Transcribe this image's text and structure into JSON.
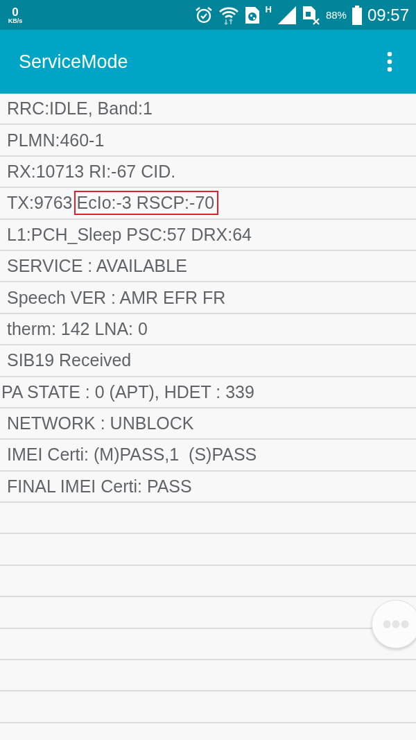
{
  "status_bar": {
    "speed": "0",
    "speed_unit": "KB/s",
    "network_type": "H",
    "battery": "88%",
    "time": "09:57"
  },
  "app_bar": {
    "title": "ServiceMode"
  },
  "rows": [
    {
      "kind": "text",
      "parts": [
        {
          "text": "RRC:IDLE, Band:1",
          "highlighted": false
        }
      ]
    },
    {
      "kind": "text",
      "parts": [
        {
          "text": "PLMN:460-1",
          "highlighted": false
        }
      ]
    },
    {
      "kind": "text",
      "parts": [
        {
          "text": "RX:10713 RI:-67 CID.",
          "highlighted": false
        }
      ]
    },
    {
      "kind": "text",
      "parts": [
        {
          "text": "TX:9763",
          "highlighted": false
        },
        {
          "text": "EcIo:-3 RSCP:-70",
          "highlighted": true
        }
      ]
    },
    {
      "kind": "text",
      "parts": [
        {
          "text": "L1:PCH_Sleep PSC:57 DRX:64",
          "highlighted": false
        }
      ]
    },
    {
      "kind": "text",
      "parts": [
        {
          "text": "SERVICE : AVAILABLE",
          "highlighted": false
        }
      ]
    },
    {
      "kind": "text",
      "parts": [
        {
          "text": "Speech VER : AMR EFR FR",
          "highlighted": false
        }
      ]
    },
    {
      "kind": "text",
      "parts": [
        {
          "text": "therm: 142 LNA: 0",
          "highlighted": false
        }
      ]
    },
    {
      "kind": "text",
      "parts": [
        {
          "text": "SIB19 Received",
          "highlighted": false
        }
      ]
    },
    {
      "kind": "flush",
      "parts": [
        {
          "text": "PA STATE : 0 (APT), HDET : 339",
          "highlighted": false
        }
      ]
    },
    {
      "kind": "text",
      "parts": [
        {
          "text": "NETWORK : UNBLOCK",
          "highlighted": false
        }
      ]
    },
    {
      "kind": "text",
      "parts": [
        {
          "text": "IMEI Certi: (M)PASS,1  (S)PASS",
          "highlighted": false
        }
      ]
    },
    {
      "kind": "text",
      "parts": [
        {
          "text": "FINAL IMEI Certi: PASS",
          "highlighted": false
        }
      ]
    }
  ]
}
